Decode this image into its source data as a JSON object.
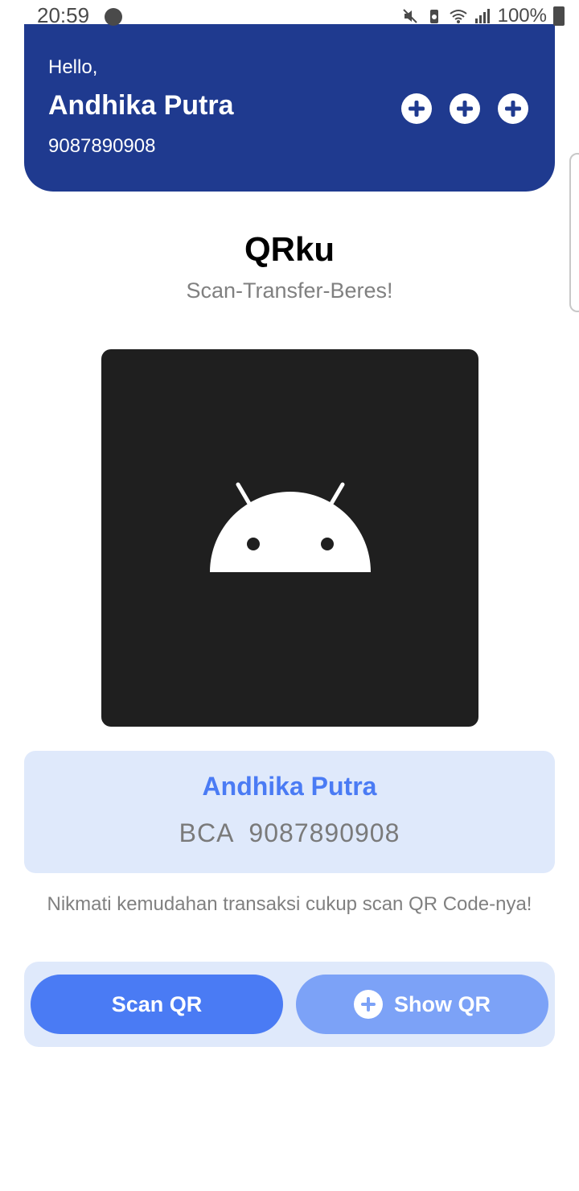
{
  "status_bar": {
    "time": "20:59",
    "battery": "100%",
    "icons": [
      "check-circle-icon",
      "mute-icon",
      "battery-saver-icon",
      "wifi-icon",
      "signal-icon",
      "battery-icon"
    ]
  },
  "header": {
    "greeting": "Hello,",
    "user_name": "Andhika Putra",
    "phone": "9087890908",
    "actions": [
      "add-icon",
      "add-icon",
      "add-icon"
    ],
    "background": "#1f3a8f"
  },
  "app": {
    "title": "QRku",
    "tagline": "Scan-Transfer-Beres!"
  },
  "qr": {
    "placeholder_icon": "android-icon"
  },
  "account": {
    "name": "Andhika Putra",
    "bank_info": "BCA  9087890908"
  },
  "hint": "Nikmati kemudahan transaksi cukup scan QR Code-nya!",
  "actions": {
    "scan_label": "Scan QR",
    "show_label": "Show QR"
  },
  "colors": {
    "primary": "#4a7bf4",
    "primary_light": "#7ca2f7",
    "card_bg": "#dfe9fb",
    "header_bg": "#1f3a8f"
  }
}
